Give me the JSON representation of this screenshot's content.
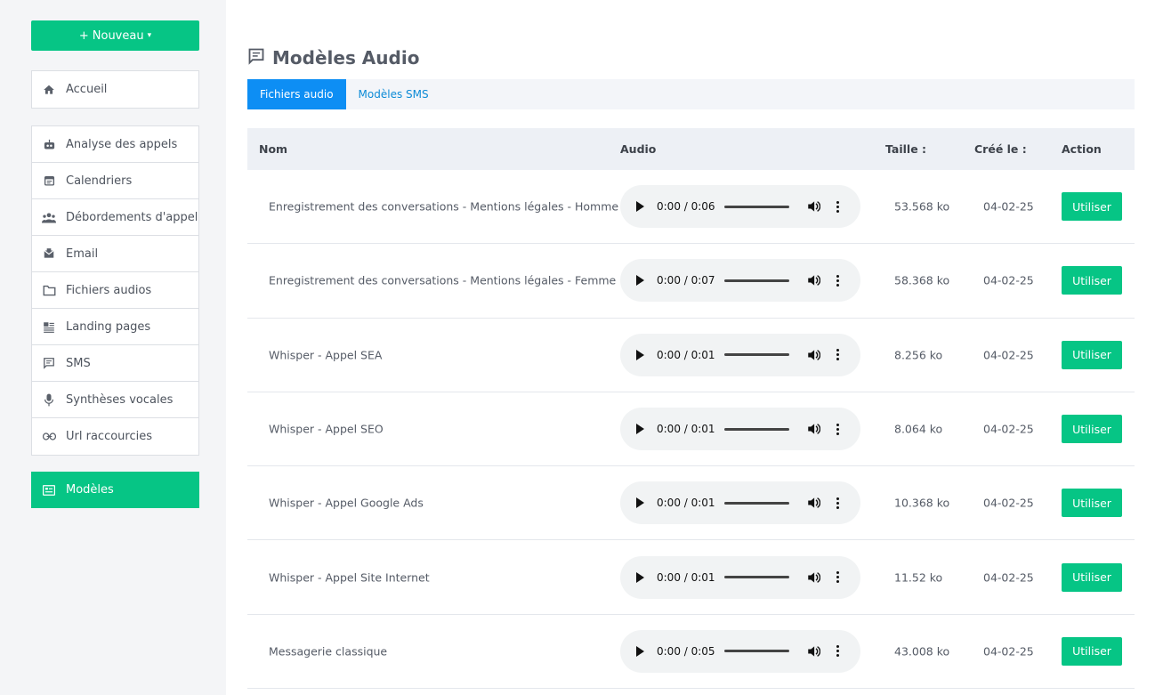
{
  "sidebar": {
    "new_label": "Nouveau",
    "home": {
      "label": "Accueil",
      "icon": "home-icon"
    },
    "items": [
      {
        "label": "Analyse des appels",
        "icon": "robot-icon"
      },
      {
        "label": "Calendriers",
        "icon": "calendar-icon"
      },
      {
        "label": "Débordements d'appel",
        "icon": "people-icon"
      },
      {
        "label": "Email",
        "icon": "mail-icon"
      },
      {
        "label": "Fichiers audios",
        "icon": "folder-icon"
      },
      {
        "label": "Landing pages",
        "icon": "article-icon"
      },
      {
        "label": "SMS",
        "icon": "message-icon"
      },
      {
        "label": "Synthèses vocales",
        "icon": "microphone-icon"
      },
      {
        "label": "Url raccourcies",
        "icon": "link-icon"
      }
    ],
    "active": {
      "label": "Modèles",
      "icon": "list-icon"
    }
  },
  "page": {
    "title": "Modèles Audio",
    "title_icon": "message-icon"
  },
  "tabs": [
    {
      "label": "Fichiers audio",
      "active": true
    },
    {
      "label": "Modèles SMS",
      "active": false
    }
  ],
  "table": {
    "headers": {
      "name": "Nom",
      "audio": "Audio",
      "size": "Taille :",
      "created": "Créé le :",
      "action": "Action"
    },
    "rows": [
      {
        "name": "Enregistrement des conversations - Mentions légales - Homme",
        "time": "0:00 / 0:06",
        "size": "53.568 ko",
        "date": "04-02-25",
        "action": "Utiliser"
      },
      {
        "name": "Enregistrement des conversations - Mentions légales - Femme",
        "time": "0:00 / 0:07",
        "size": "58.368 ko",
        "date": "04-02-25",
        "action": "Utiliser"
      },
      {
        "name": "Whisper - Appel SEA",
        "time": "0:00 / 0:01",
        "size": "8.256 ko",
        "date": "04-02-25",
        "action": "Utiliser"
      },
      {
        "name": "Whisper - Appel SEO",
        "time": "0:00 / 0:01",
        "size": "8.064 ko",
        "date": "04-02-25",
        "action": "Utiliser"
      },
      {
        "name": "Whisper - Appel Google Ads",
        "time": "0:00 / 0:01",
        "size": "10.368 ko",
        "date": "04-02-25",
        "action": "Utiliser"
      },
      {
        "name": "Whisper - Appel Site Internet",
        "time": "0:00 / 0:01",
        "size": "11.52 ko",
        "date": "04-02-25",
        "action": "Utiliser"
      },
      {
        "name": "Messagerie classique",
        "time": "0:00 / 0:05",
        "size": "43.008 ko",
        "date": "04-02-25",
        "action": "Utiliser"
      }
    ]
  },
  "colors": {
    "accent": "#06c585",
    "tab_active": "#0d8ef4"
  }
}
